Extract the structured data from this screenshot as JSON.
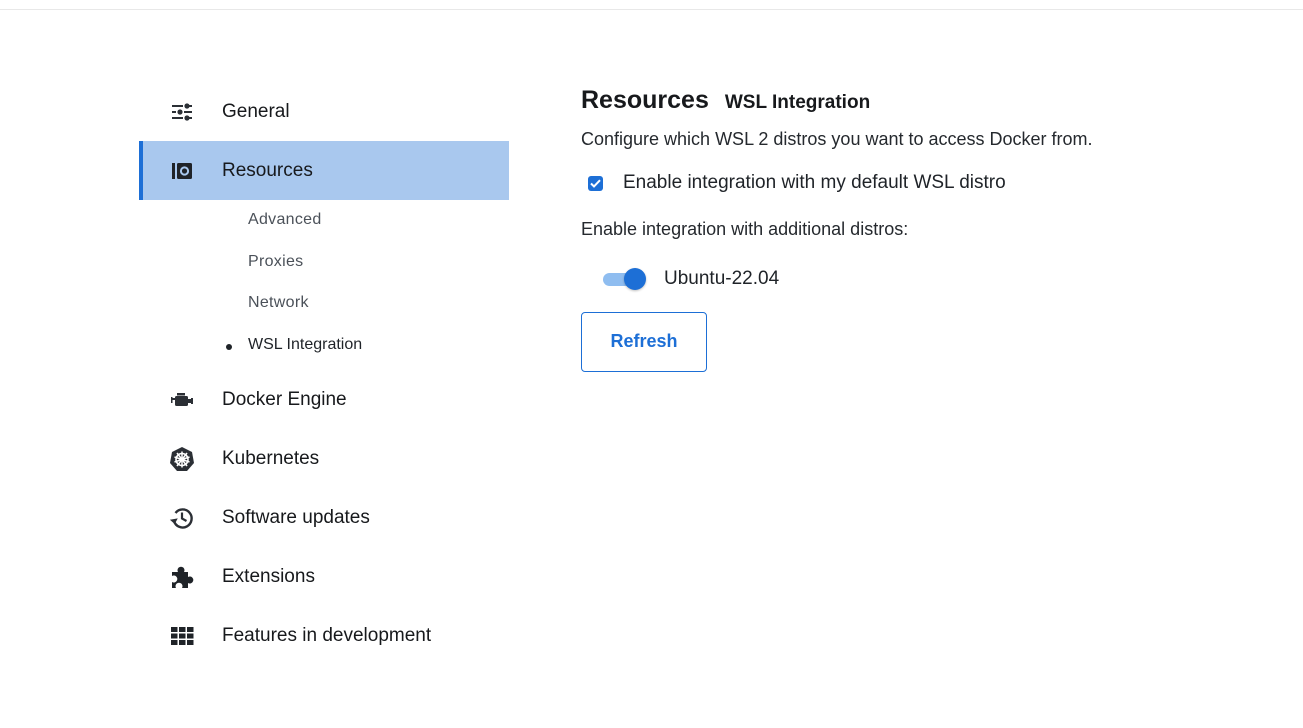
{
  "sidebar": {
    "items": [
      {
        "label": "General",
        "icon": "sliders-icon"
      },
      {
        "label": "Resources",
        "icon": "resources-icon",
        "active": true
      },
      {
        "label": "Docker Engine",
        "icon": "engine-icon"
      },
      {
        "label": "Kubernetes",
        "icon": "kubernetes-icon"
      },
      {
        "label": "Software updates",
        "icon": "history-icon"
      },
      {
        "label": "Extensions",
        "icon": "puzzle-icon"
      },
      {
        "label": "Features in development",
        "icon": "grid-icon"
      }
    ],
    "resources_sub": [
      {
        "label": "Advanced"
      },
      {
        "label": "Proxies"
      },
      {
        "label": "Network"
      },
      {
        "label": "WSL Integration",
        "current": true
      }
    ]
  },
  "main": {
    "title": "Resources",
    "subtitle": "WSL Integration",
    "description": "Configure which WSL 2 distros you want to access Docker from.",
    "default_checkbox": {
      "label": "Enable integration with my default WSL distro",
      "checked": true
    },
    "additional_label": "Enable integration with additional distros:",
    "distros": [
      {
        "name": "Ubuntu-22.04",
        "enabled": true
      }
    ],
    "refresh_label": "Refresh"
  },
  "colors": {
    "accent": "#1d6fd6",
    "active_bg": "#a9c8ee",
    "toggle_track": "#8fbdf0"
  }
}
